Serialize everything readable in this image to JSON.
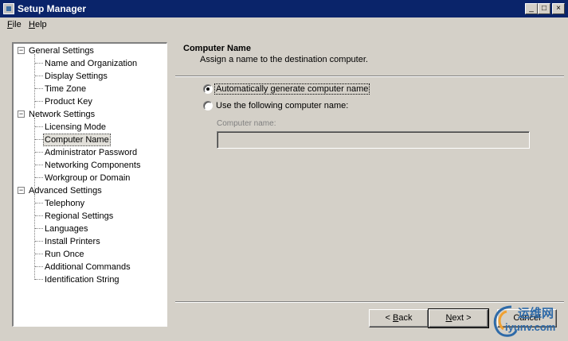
{
  "window": {
    "title": "Setup Manager",
    "minimize_glyph": "_",
    "maximize_glyph": "□",
    "close_glyph": "×"
  },
  "menu": {
    "file": {
      "accel": "F",
      "rest": "ile"
    },
    "help": {
      "accel": "H",
      "rest": "elp"
    }
  },
  "tree": {
    "expander_minus": "−",
    "groups": [
      {
        "label": "General Settings",
        "expanded": true,
        "items": [
          "Name and Organization",
          "Display Settings",
          "Time Zone",
          "Product Key"
        ]
      },
      {
        "label": "Network Settings",
        "expanded": true,
        "items": [
          "Licensing Mode",
          "Computer Name",
          "Administrator Password",
          "Networking Components",
          "Workgroup or Domain"
        ]
      },
      {
        "label": "Advanced Settings",
        "expanded": true,
        "items": [
          "Telephony",
          "Regional Settings",
          "Languages",
          "Install Printers",
          "Run Once",
          "Additional Commands",
          "Identification String"
        ]
      }
    ],
    "selected": "Computer Name"
  },
  "page": {
    "heading": "Computer Name",
    "subheading": "Assign a name to the destination computer."
  },
  "options": {
    "auto_generate": {
      "label": "Automatically generate computer name",
      "checked": true
    },
    "use_following": {
      "label": "Use the following computer name:",
      "checked": false
    }
  },
  "computer_name_field": {
    "label": "Computer name:",
    "value": "",
    "enabled": false
  },
  "buttons": {
    "back": {
      "pre": "< ",
      "accel": "B",
      "rest": "ack"
    },
    "next": {
      "accel": "N",
      "rest": "ext >"
    },
    "cancel": "Cancel"
  },
  "watermark": {
    "cn_text": "运维网",
    "url": "iyunv.com"
  },
  "colors": {
    "titlebar": "#0a246a",
    "face": "#d4d0c8",
    "disabled_text": "#808080",
    "watermark": "#2e6aa8"
  }
}
